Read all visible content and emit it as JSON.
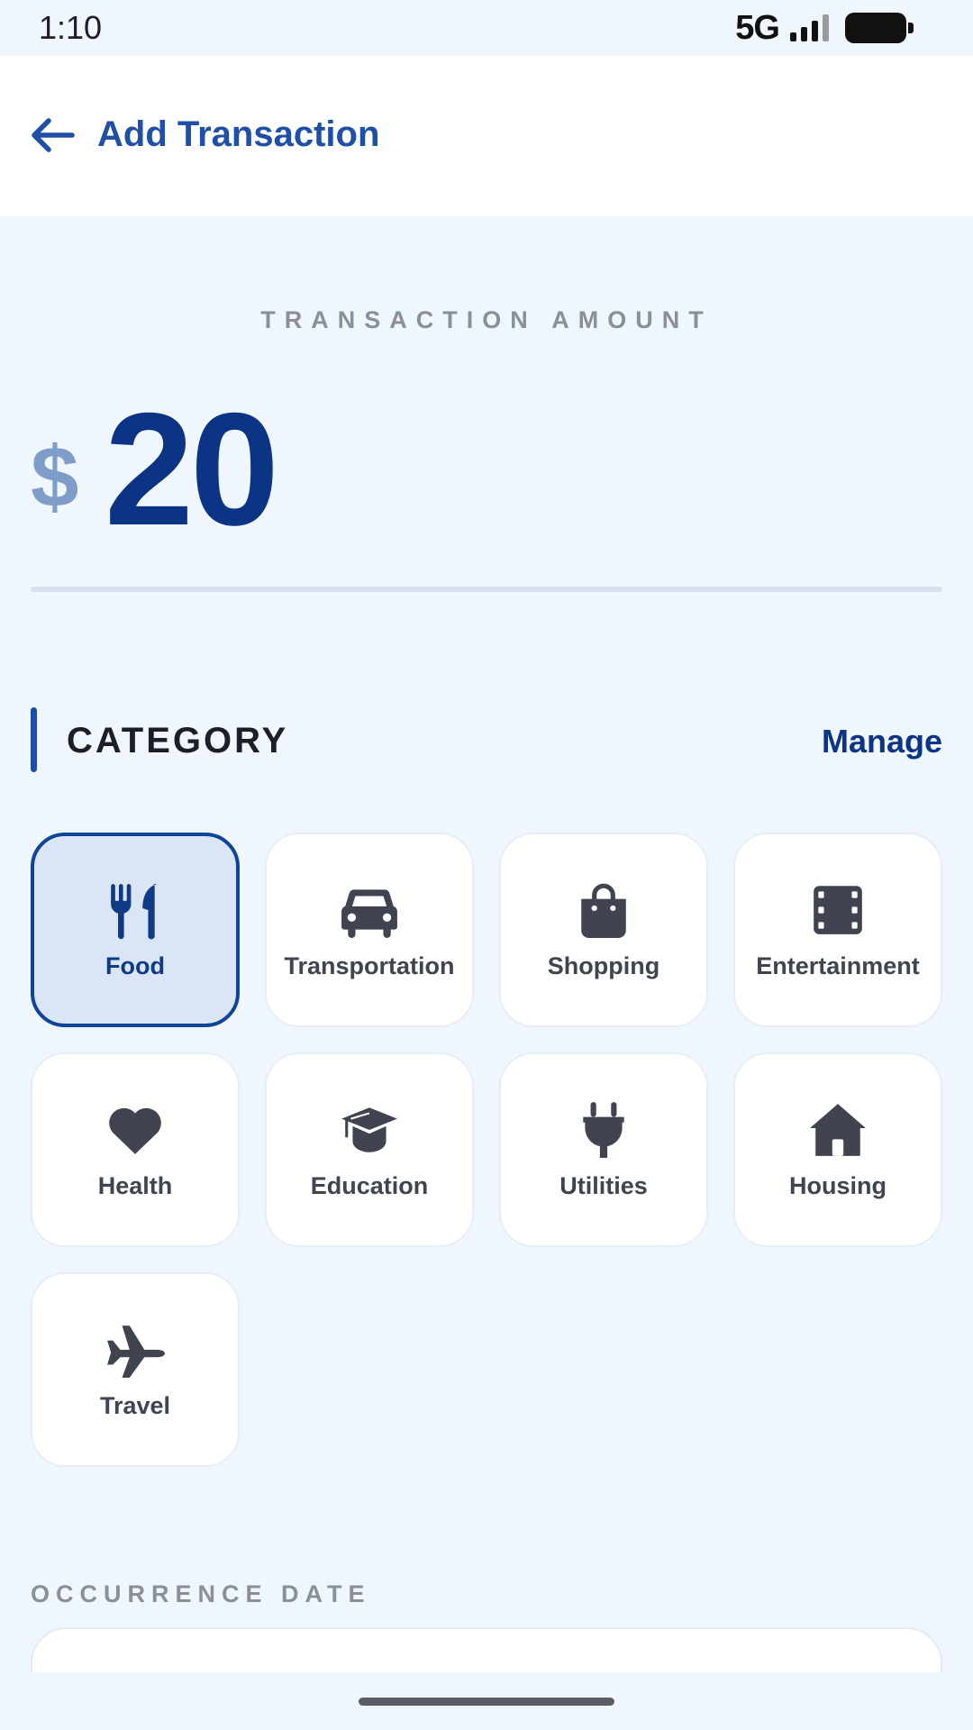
{
  "status_bar": {
    "time": "1:10",
    "network": "5G",
    "icons": [
      "signal-icon",
      "battery-icon"
    ]
  },
  "app_bar": {
    "back_icon": "arrow-left-icon",
    "title": "Add Transaction"
  },
  "amount": {
    "label": "TRANSACTION AMOUNT",
    "currency": "$",
    "value": "20"
  },
  "category": {
    "title": "CATEGORY",
    "manage_label": "Manage",
    "selected": "Food",
    "items": [
      {
        "label": "Food",
        "icon": "utensils-icon"
      },
      {
        "label": "Transportation",
        "icon": "car-icon"
      },
      {
        "label": "Shopping",
        "icon": "shopping-bag-icon"
      },
      {
        "label": "Entertainment",
        "icon": "film-icon"
      },
      {
        "label": "Health",
        "icon": "heart-icon"
      },
      {
        "label": "Education",
        "icon": "graduation-cap-icon"
      },
      {
        "label": "Utilities",
        "icon": "plug-icon"
      },
      {
        "label": "Housing",
        "icon": "house-icon"
      },
      {
        "label": "Travel",
        "icon": "plane-icon"
      }
    ]
  },
  "occurrence_date": {
    "label": "OCCURRENCE DATE"
  },
  "colors": {
    "primary": "#0b3485",
    "accent": "#1f4fa6",
    "background": "#eff6fd",
    "selected_fill": "#dae6f5",
    "icon_gray": "#404451"
  }
}
